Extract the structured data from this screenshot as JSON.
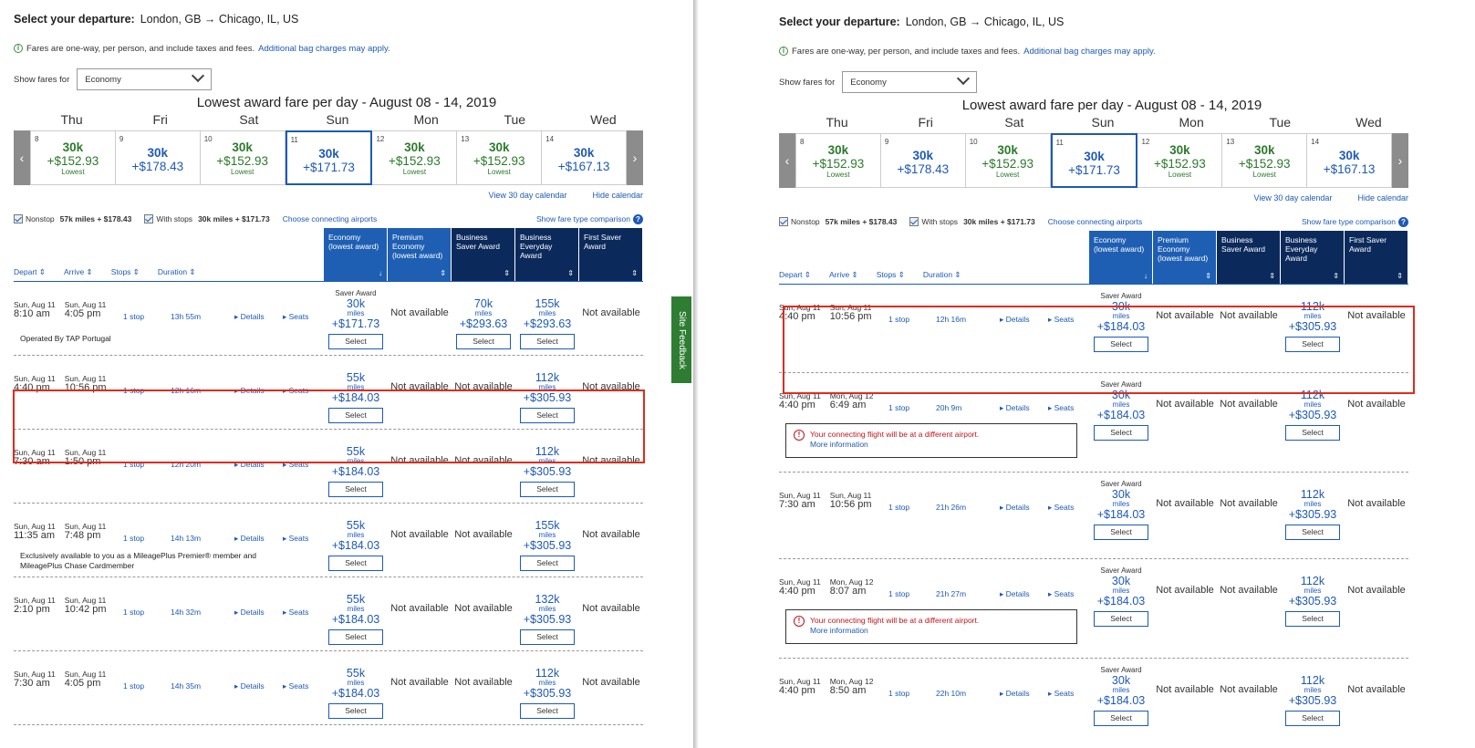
{
  "left": {
    "departure_label": "Select your departure:",
    "route": "London, GB → Chicago, IL, US",
    "notice": "Fares are one-way, per person, and include taxes and fees.",
    "notice_link": "Additional bag charges may apply.",
    "show_fares_label": "Show fares for",
    "cabin_selected": "Economy",
    "cal_title": "Lowest award fare per day - August 08 - 14, 2019",
    "day_names": [
      "Thu",
      "Fri",
      "Sat",
      "Sun",
      "Mon",
      "Tue",
      "Wed"
    ],
    "cal": [
      {
        "d": "8",
        "m": "30k",
        "p": "+$152.93",
        "l": "Lowest",
        "blue": false
      },
      {
        "d": "9",
        "m": "30k",
        "p": "+$178.43",
        "l": "",
        "blue": true
      },
      {
        "d": "10",
        "m": "30k",
        "p": "+$152.93",
        "l": "Lowest",
        "blue": false
      },
      {
        "d": "11",
        "m": "30k",
        "p": "+$171.73",
        "l": "",
        "blue": true
      },
      {
        "d": "12",
        "m": "30k",
        "p": "+$152.93",
        "l": "Lowest",
        "blue": false
      },
      {
        "d": "13",
        "m": "30k",
        "p": "+$152.93",
        "l": "Lowest",
        "blue": false
      },
      {
        "d": "14",
        "m": "30k",
        "p": "+$167.13",
        "l": "",
        "blue": true
      }
    ],
    "view30": "View 30 day calendar",
    "hide_cal": "Hide calendar",
    "nonstop": "Nonstop",
    "nonstop_price": "57k miles + $178.43",
    "withstops": "With stops",
    "withstops_price": "30k miles + $171.73",
    "connecting": "Choose connecting airports",
    "fare_compare": "Show fare type comparison",
    "sort": [
      "Depart ⇕",
      "Arrive ⇕",
      "Stops ⇕",
      "Duration ⇕"
    ],
    "cabins": [
      "Economy (lowest award)",
      "Premium Economy (lowest award)",
      "Business Saver Award",
      "Business Everyday Award",
      "First Saver Award"
    ],
    "rows": [
      {
        "dd": "Sun, Aug 11",
        "dt": "8:10 am",
        "ad": "Sun, Aug 11",
        "at": "4:05 pm",
        "stops": "1 stop",
        "dur": "13h 55m",
        "note": "Operated By TAP Portugal",
        "f1": {
          "sa": "Saver Award",
          "m": "30k",
          "p": "+$171.73"
        },
        "f2": "Not available",
        "f3": {
          "m": "70k",
          "p": "+$293.63"
        },
        "f4": {
          "m": "155k",
          "p": "+$293.63"
        },
        "f5": "Not available"
      },
      {
        "dd": "Sun, Aug 11",
        "dt": "4:40 pm",
        "ad": "Sun, Aug 11",
        "at": "10:56 pm",
        "stops": "1 stop",
        "dur": "12h 16m",
        "note": "",
        "f1": {
          "sa": "",
          "m": "55k",
          "p": "+$184.03"
        },
        "f2": "Not available",
        "f3": "Not available",
        "f4": {
          "m": "112k",
          "p": "+$305.93"
        },
        "f5": "Not available"
      },
      {
        "dd": "Sun, Aug 11",
        "dt": "7:30 am",
        "ad": "Sun, Aug 11",
        "at": "1:50 pm",
        "stops": "1 stop",
        "dur": "12h 20m",
        "note": "",
        "f1": {
          "sa": "",
          "m": "55k",
          "p": "+$184.03"
        },
        "f2": "Not available",
        "f3": "Not available",
        "f4": {
          "m": "112k",
          "p": "+$305.93"
        },
        "f5": "Not available"
      },
      {
        "dd": "Sun, Aug 11",
        "dt": "11:35 am",
        "ad": "Sun, Aug 11",
        "at": "7:48 pm",
        "stops": "1 stop",
        "dur": "14h 13m",
        "note": "Exclusively available to you as a MileagePlus Premier® member and MileagePlus Chase Cardmember",
        "f1": {
          "sa": "",
          "m": "55k",
          "p": "+$184.03"
        },
        "f2": "Not available",
        "f3": "Not available",
        "f4": {
          "m": "155k",
          "p": "+$305.93"
        },
        "f5": "Not available"
      },
      {
        "dd": "Sun, Aug 11",
        "dt": "2:10 pm",
        "ad": "Sun, Aug 11",
        "at": "10:42 pm",
        "stops": "1 stop",
        "dur": "14h 32m",
        "note": "",
        "f1": {
          "sa": "",
          "m": "55k",
          "p": "+$184.03"
        },
        "f2": "Not available",
        "f3": "Not available",
        "f4": {
          "m": "132k",
          "p": "+$305.93"
        },
        "f5": "Not available"
      },
      {
        "dd": "Sun, Aug 11",
        "dt": "7:30 am",
        "ad": "Sun, Aug 11",
        "at": "4:05 pm",
        "stops": "1 stop",
        "dur": "14h 35m",
        "note": "",
        "f1": {
          "sa": "",
          "m": "55k",
          "p": "+$184.03"
        },
        "f2": "Not available",
        "f3": "Not available",
        "f4": {
          "m": "112k",
          "p": "+$305.93"
        },
        "f5": "Not available"
      }
    ]
  },
  "right": {
    "rows": [
      {
        "dd": "Sun, Aug 11",
        "dt": "4:40 pm",
        "ad": "Sun, Aug 11",
        "at": "10:56 pm",
        "stops": "1 stop",
        "dur": "12h 16m",
        "warn": false,
        "f1": {
          "sa": "Saver Award",
          "m": "30k",
          "p": "+$184.03"
        },
        "f2": "Not available",
        "f3": "Not available",
        "f4": {
          "m": "112k",
          "p": "+$305.93"
        },
        "f5": "Not available"
      },
      {
        "dd": "Sun, Aug 11",
        "dt": "4:40 pm",
        "ad": "Mon, Aug 12",
        "at": "6:49 am",
        "stops": "1 stop",
        "dur": "20h 9m",
        "warn": true,
        "f1": {
          "sa": "Saver Award",
          "m": "30k",
          "p": "+$184.03"
        },
        "f2": "Not available",
        "f3": "Not available",
        "f4": {
          "m": "112k",
          "p": "+$305.93"
        },
        "f5": "Not available"
      },
      {
        "dd": "Sun, Aug 11",
        "dt": "7:30 am",
        "ad": "Sun, Aug 11",
        "at": "10:56 pm",
        "stops": "1 stop",
        "dur": "21h 26m",
        "warn": false,
        "f1": {
          "sa": "Saver Award",
          "m": "30k",
          "p": "+$184.03"
        },
        "f2": "Not available",
        "f3": "Not available",
        "f4": {
          "m": "112k",
          "p": "+$305.93"
        },
        "f5": "Not available"
      },
      {
        "dd": "Sun, Aug 11",
        "dt": "4:40 pm",
        "ad": "Mon, Aug 12",
        "at": "8:07 am",
        "stops": "1 stop",
        "dur": "21h 27m",
        "warn": true,
        "f1": {
          "sa": "Saver Award",
          "m": "30k",
          "p": "+$184.03"
        },
        "f2": "Not available",
        "f3": "Not available",
        "f4": {
          "m": "112k",
          "p": "+$305.93"
        },
        "f5": "Not available"
      },
      {
        "dd": "Sun, Aug 11",
        "dt": "4:40 pm",
        "ad": "Mon, Aug 12",
        "at": "8:50 am",
        "stops": "1 stop",
        "dur": "22h 10m",
        "warn": false,
        "f1": {
          "sa": "Saver Award",
          "m": "30k",
          "p": "+$184.03"
        },
        "f2": "Not available",
        "f3": "Not available",
        "f4": {
          "m": "112k",
          "p": "+$305.93"
        },
        "f5": "Not available"
      }
    ]
  },
  "common": {
    "miles_unit": "miles",
    "select_label": "Select",
    "details": "Details",
    "seats": "Seats",
    "warn_text": "Your connecting flight will be at a different airport.",
    "warn_more": "More information",
    "feedback": "Site Feedback",
    "lowest": "Lowest"
  }
}
